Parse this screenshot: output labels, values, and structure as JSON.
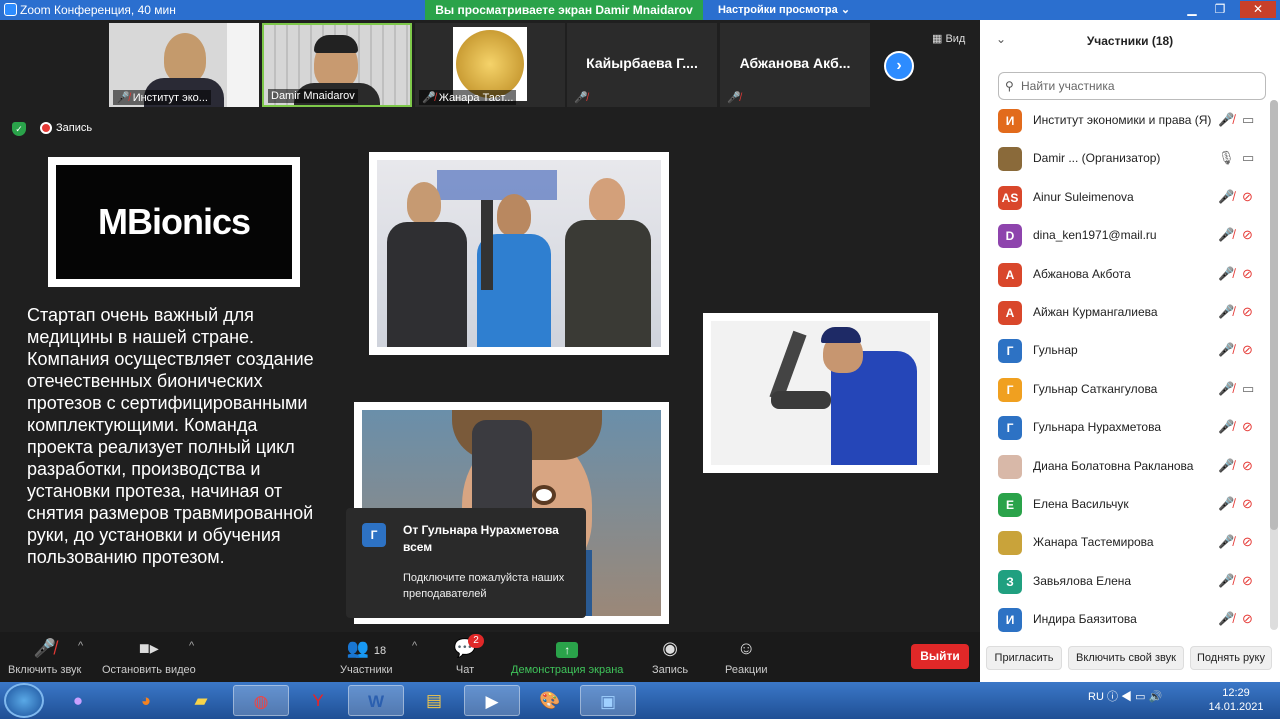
{
  "titlebar": {
    "title": "Zoom Конференция, 40 мин",
    "viewing_banner": "Вы просматриваете экран Damir Mnaidarov",
    "view_options": "Настройки просмотра ⌄"
  },
  "strip": {
    "thumbs": [
      {
        "name": "Институт эко..."
      },
      {
        "name": "Damir Mnaidarov"
      },
      {
        "name": "Жанара Таст..."
      },
      {
        "big": "Кайырбаева  Г....",
        "name": ""
      },
      {
        "big": "Абжанова  Акб...",
        "name": ""
      }
    ],
    "view_label": "Вид"
  },
  "recording_label": "Запись",
  "slide": {
    "logo_text": "MBionics",
    "description": "Стартап очень важный для медицины в нашей стране. Компания осуществляет создание отечественных бионических протезов с сертифицированными комплектующими. Команда проекта реализует полный цикл разработки, производства и установки протеза, начиная от снятия размеров травмированной руки, до установки и обучения пользованию протезом."
  },
  "chat_popup": {
    "avatar": "Г",
    "from": "От Гульнара Нурахметова всем",
    "message": "Подключите пожалуйста наших преподавателей"
  },
  "toolbar": {
    "unmute": "Включить звук",
    "stop_video": "Остановить видео",
    "participants": "Участники",
    "participants_count": "18",
    "chat": "Чат",
    "chat_badge": "2",
    "share": "Демонстрация экрана",
    "record": "Запись",
    "reactions": "Реакции",
    "exit": "Выйти"
  },
  "panel": {
    "title": "Участники (18)",
    "search_placeholder": "Найти участника",
    "participants": [
      {
        "initials": "И",
        "name": "Институт экономики и права (Я)",
        "color": "#e26b1c"
      },
      {
        "initials": "",
        "name": "Damir ...   (Организатор)",
        "color": "#8a6a3a"
      },
      {
        "initials": "AS",
        "name": "Ainur Suleimenova",
        "color": "#d9472b"
      },
      {
        "initials": "D",
        "name": "dina_ken1971@mail.ru",
        "color": "#8e44ad"
      },
      {
        "initials": "А",
        "name": "Абжанова Акбота",
        "color": "#d9472b"
      },
      {
        "initials": "А",
        "name": "Айжан Курмангалиева",
        "color": "#d9472b"
      },
      {
        "initials": "Г",
        "name": "Гульнар",
        "color": "#2d72c4"
      },
      {
        "initials": "Г",
        "name": "Гульнар Саткангулова",
        "color": "#f0a020"
      },
      {
        "initials": "Г",
        "name": "Гульнара Нурахметова",
        "color": "#2d72c4"
      },
      {
        "initials": "",
        "name": "Диана Болатовна Ракланова",
        "color": "#d8b8a8"
      },
      {
        "initials": "Е",
        "name": "Елена Васильчук",
        "color": "#2aa34a"
      },
      {
        "initials": "",
        "name": "Жанара Тастемирова",
        "color": "#c9a33a"
      },
      {
        "initials": "З",
        "name": "Завьялова Елена",
        "color": "#20a080"
      },
      {
        "initials": "И",
        "name": "Индира Баязитова",
        "color": "#2d72c4"
      }
    ],
    "invite": "Пригласить",
    "unmute_me": "Включить свой звук",
    "raise_hand": "Поднять руку"
  },
  "taskbar": {
    "lang": "RU",
    "time": "12:29",
    "date": "14.01.2021"
  },
  "colors": {
    "zoom_blue": "#2d8cff",
    "green": "#2aa34a",
    "red": "#e02828"
  }
}
